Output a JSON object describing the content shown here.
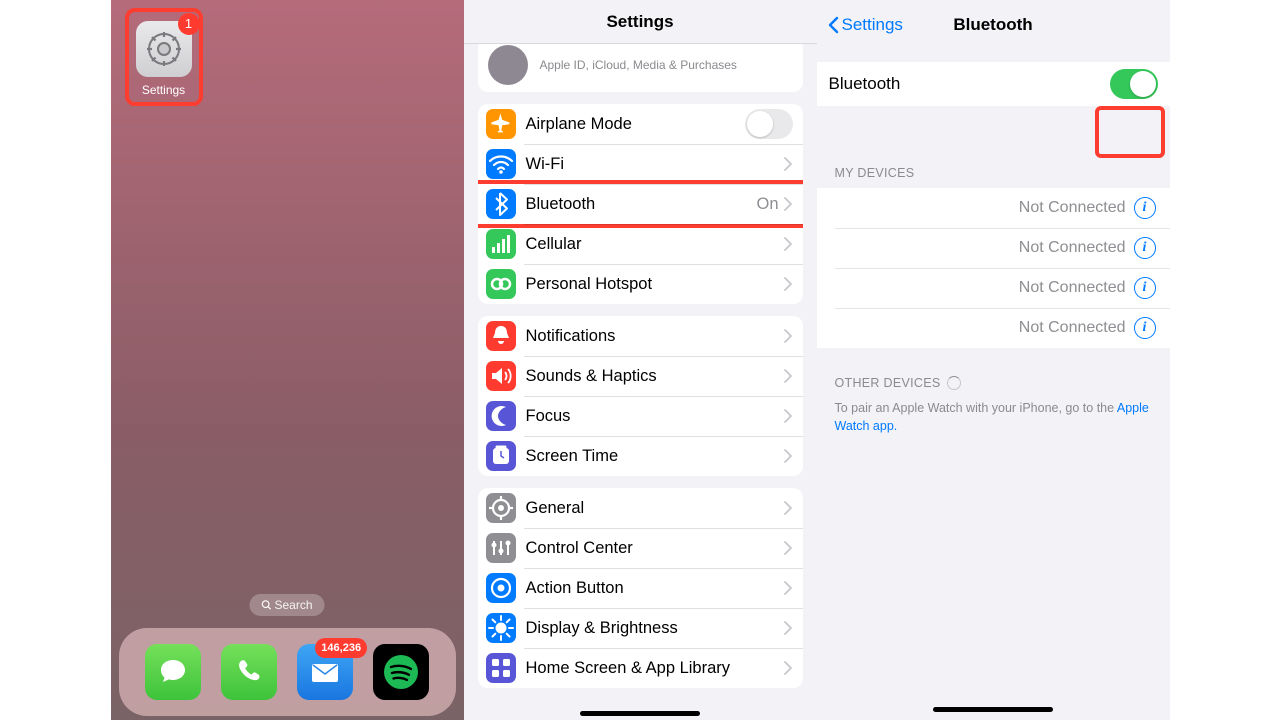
{
  "panel1": {
    "settings_label": "Settings",
    "settings_badge": "1",
    "search_label": "Search",
    "mail_badge": "146,236"
  },
  "panel2": {
    "title": "Settings",
    "apple_sub": "Apple ID, iCloud, Media & Purchases",
    "group1": [
      {
        "label": "Airplane Mode",
        "kind": "toggle",
        "on": false
      },
      {
        "label": "Wi-Fi",
        "kind": "link",
        "value": ""
      },
      {
        "label": "Bluetooth",
        "kind": "link",
        "value": "On",
        "highlight": true
      },
      {
        "label": "Cellular",
        "kind": "link",
        "value": ""
      },
      {
        "label": "Personal Hotspot",
        "kind": "link",
        "value": ""
      }
    ],
    "group2": [
      {
        "label": "Notifications"
      },
      {
        "label": "Sounds & Haptics"
      },
      {
        "label": "Focus"
      },
      {
        "label": "Screen Time"
      }
    ],
    "group3": [
      {
        "label": "General"
      },
      {
        "label": "Control Center"
      },
      {
        "label": "Action Button"
      },
      {
        "label": "Display & Brightness"
      },
      {
        "label": "Home Screen & App Library"
      }
    ]
  },
  "panel3": {
    "back": "Settings",
    "title": "Bluetooth",
    "bt_label": "Bluetooth",
    "bt_on": true,
    "my_header": "MY DEVICES",
    "devices": [
      {
        "status": "Not Connected"
      },
      {
        "status": "Not Connected"
      },
      {
        "status": "Not Connected"
      },
      {
        "status": "Not Connected"
      }
    ],
    "other_header": "OTHER DEVICES",
    "footer_pre": "To pair an Apple Watch with your iPhone, go to the ",
    "footer_link": "Apple Watch app."
  },
  "colors": {
    "airplane": "#ff9500",
    "wifi": "#007aff",
    "bluetooth": "#007aff",
    "cellular": "#34c759",
    "hotspot": "#34c759",
    "notifications": "#ff3b30",
    "sounds": "#ff3b30",
    "focus": "#5856d6",
    "screentime": "#5856d6",
    "general": "#8e8e93",
    "controlcenter": "#8e8e93",
    "actionbutton": "#007aff",
    "display": "#007aff",
    "homescreen": "#5856d6"
  }
}
